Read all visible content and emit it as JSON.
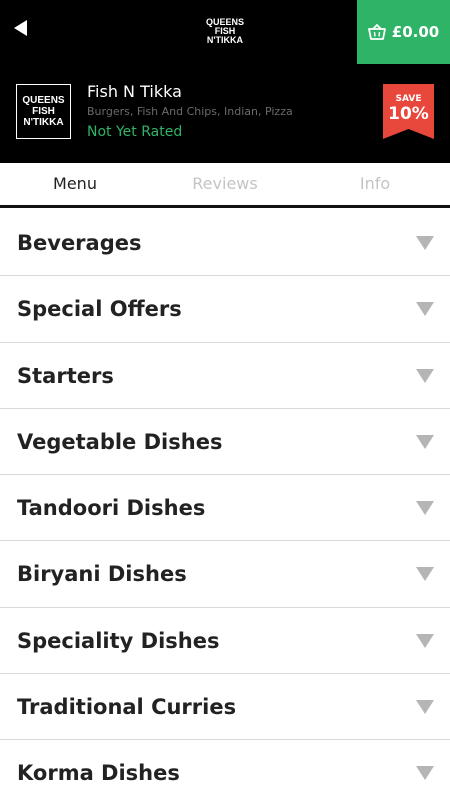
{
  "topbar": {
    "logo_lines": [
      "QUEENS",
      "FISH",
      "N'TIKKA"
    ],
    "cart_amount": "£0.00",
    "accent": "#2fb366"
  },
  "restaurant": {
    "logo_lines": [
      "QUEENS",
      "FISH",
      "N'TIKKA"
    ],
    "name": "Fish N Tikka",
    "cuisines": "Burgers, Fish And Chips, Indian, Pizza",
    "rating": "Not Yet Rated",
    "save_label": "SAVE",
    "save_percent": "10%",
    "save_color": "#e8473c"
  },
  "tabs": [
    {
      "label": "Menu",
      "active": true
    },
    {
      "label": "Reviews",
      "active": false
    },
    {
      "label": "Info",
      "active": false
    }
  ],
  "menu": {
    "categories": [
      "Beverages",
      "Special Offers",
      "Starters",
      "Vegetable Dishes",
      "Tandoori Dishes",
      "Biryani Dishes",
      "Speciality Dishes",
      "Traditional Curries",
      "Korma Dishes"
    ]
  }
}
